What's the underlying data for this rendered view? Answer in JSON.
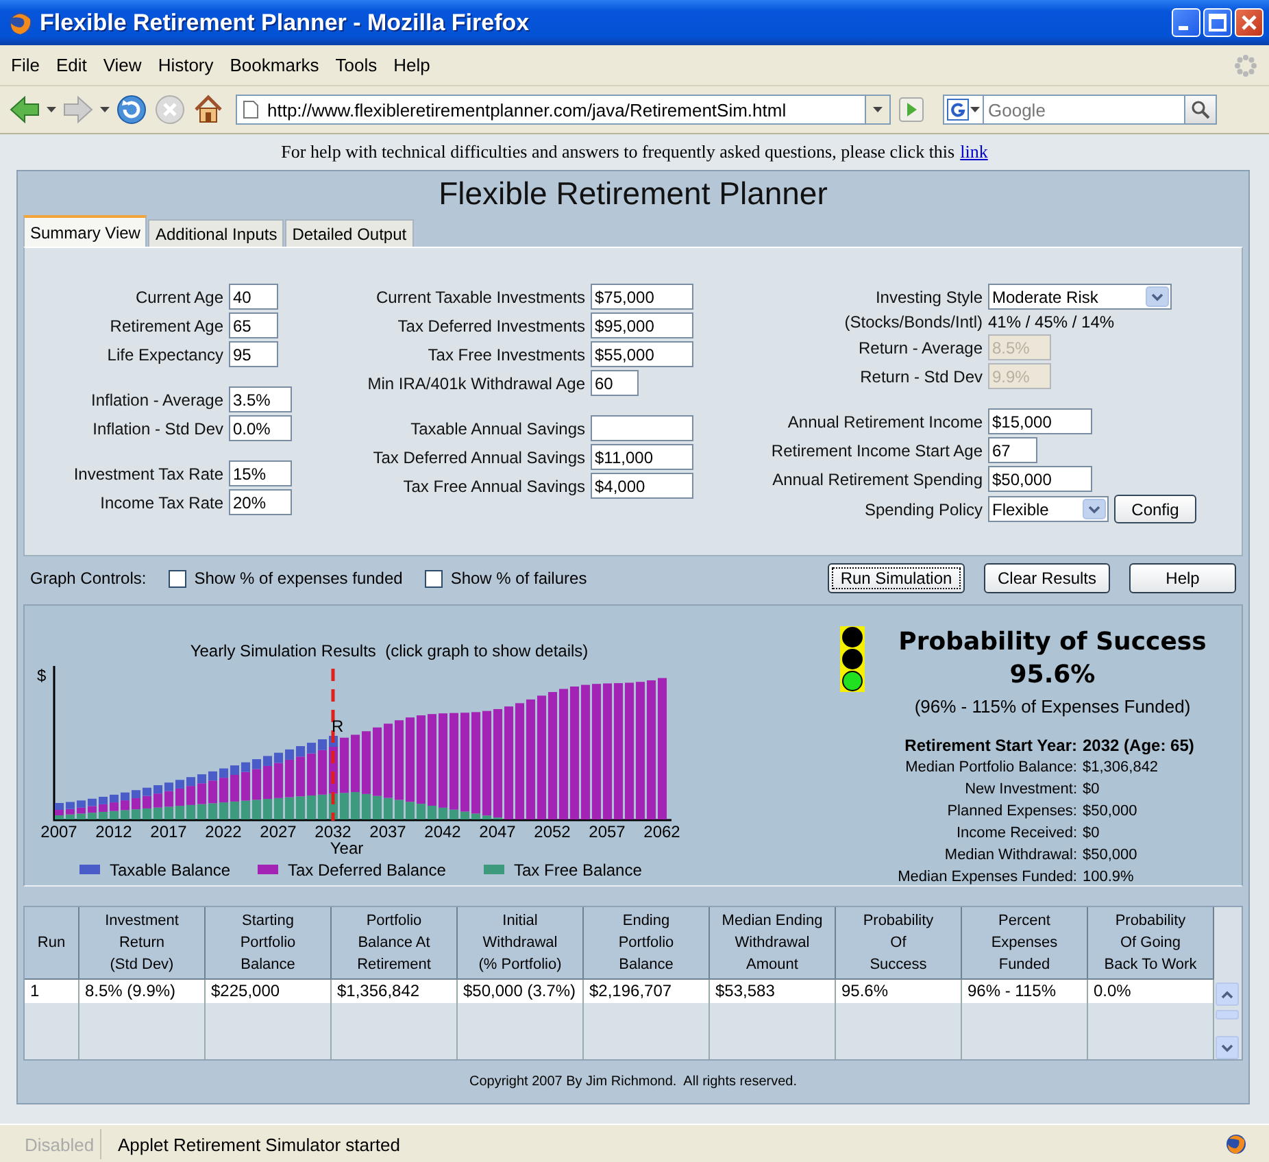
{
  "window": {
    "title": "Flexible Retirement Planner - Mozilla Firefox"
  },
  "menu": [
    "File",
    "Edit",
    "View",
    "History",
    "Bookmarks",
    "Tools",
    "Help"
  ],
  "address_bar": {
    "value": "http://www.flexibleretirementplanner.com/java/RetirementSim.html"
  },
  "search": {
    "placeholder": "Google"
  },
  "help_line": {
    "text": "For help with technical difficulties and answers to frequently asked questions, please click this",
    "link": "link"
  },
  "app_title": "Flexible Retirement Planner",
  "tabs": [
    {
      "label": "Summary View",
      "selected": true
    },
    {
      "label": "Additional Inputs",
      "selected": false
    },
    {
      "label": "Detailed Output",
      "selected": false
    }
  ],
  "input_columns": [
    [
      [
        {
          "label": "Current Age",
          "value": "40",
          "kind": "input",
          "disabled": false
        },
        {
          "label": "Retirement Age",
          "value": "65",
          "kind": "input",
          "disabled": false
        },
        {
          "label": "Life Expectancy",
          "value": "95",
          "kind": "input",
          "disabled": false
        }
      ],
      [
        {
          "label": "Inflation - Average",
          "value": "3.5%",
          "kind": "input",
          "disabled": false
        },
        {
          "label": "Inflation - Std Dev",
          "value": "0.0%",
          "kind": "input",
          "disabled": false
        }
      ],
      [
        {
          "label": "Investment Tax Rate",
          "value": "15%",
          "kind": "input",
          "disabled": false
        },
        {
          "label": "Income Tax Rate",
          "value": "20%",
          "kind": "input",
          "disabled": false
        }
      ]
    ],
    [
      [
        {
          "label": "Current Taxable Investments",
          "value": "$75,000",
          "kind": "input",
          "disabled": false
        },
        {
          "label": "Tax Deferred Investments",
          "value": "$95,000",
          "kind": "input",
          "disabled": false
        },
        {
          "label": "Tax Free Investments",
          "value": "$55,000",
          "kind": "input",
          "disabled": false
        },
        {
          "label": "Min IRA/401k Withdrawal Age",
          "value": "60",
          "kind": "input",
          "disabled": false
        }
      ],
      [
        {
          "label": "Taxable Annual Savings",
          "kind": "input",
          "disabled": false
        },
        {
          "label": "Tax Deferred Annual Savings",
          "value": "$11,000",
          "kind": "input",
          "disabled": false
        },
        {
          "label": "Tax Free Annual Savings",
          "value": "$4,000",
          "kind": "input",
          "disabled": false
        }
      ]
    ],
    [
      [
        {
          "label": "Investing Style",
          "value": "Moderate Risk",
          "kind": "select",
          "disabled": false
        },
        {
          "label": "(Stocks/Bonds/Intl)",
          "value": "41% / 45% / 14%",
          "kind": "readout",
          "disabled": false
        },
        {
          "label": "Return - Average",
          "value": "8.5%",
          "kind": "input",
          "disabled": true
        },
        {
          "label": "Return - Std Dev",
          "value": "9.9%",
          "kind": "input",
          "disabled": true
        }
      ],
      [
        {
          "label": "Annual Retirement Income",
          "value": "$15,000",
          "kind": "input",
          "disabled": false
        },
        {
          "label": "Retirement Income Start Age",
          "value": "67",
          "kind": "input",
          "disabled": false
        },
        {
          "label": "Annual Retirement Spending",
          "value": "$50,000",
          "kind": "input",
          "disabled": false
        },
        {
          "label": "Spending Policy",
          "value": "Flexible",
          "kind": "select",
          "disabled": false,
          "button": "Config"
        }
      ]
    ]
  ],
  "graph_controls": {
    "label": "Graph Controls:",
    "checkboxes": [
      {
        "label": "Show % of expenses funded",
        "checked": false
      },
      {
        "label": "Show % of failures",
        "checked": false
      }
    ],
    "buttons": [
      {
        "label": "Run Simulation",
        "focused": true
      },
      {
        "label": "Clear Results",
        "focused": false
      },
      {
        "label": "Help",
        "focused": false
      }
    ]
  },
  "chart": {
    "title": "Yearly Simulation Results  (click graph to show details)",
    "ylabel": "$",
    "xlabel": "Year",
    "retirement_marker": "R",
    "xticks": [
      "2007",
      "2012",
      "2017",
      "2022",
      "2027",
      "2032",
      "2037",
      "2042",
      "2047",
      "2052",
      "2057",
      "2062"
    ],
    "legend": [
      {
        "label": "Taxable Balance",
        "color": "#4a5cc8"
      },
      {
        "label": "Tax Deferred Balance",
        "color": "#a323b4"
      },
      {
        "label": "Tax Free Balance",
        "color": "#3e9a7c"
      }
    ]
  },
  "result": {
    "lights": [
      {
        "on": false
      },
      {
        "on": false
      },
      {
        "on": true
      }
    ],
    "heading": "Probability of Success",
    "value": "95.6%",
    "range": "(96% - 115% of Expenses Funded)",
    "details": [
      {
        "label": "Retirement Start Year:",
        "value": "2032 (Age: 65)",
        "emphasis": true
      },
      {
        "label": "Median Portfolio Balance:",
        "value": "$1,306,842",
        "emphasis": false
      },
      {
        "label": "New Investment:",
        "value": "$0",
        "emphasis": false
      },
      {
        "label": "Planned Expenses:",
        "value": "$50,000",
        "emphasis": false
      },
      {
        "label": "Income Received:",
        "value": "$0",
        "emphasis": false
      },
      {
        "label": "Median Withdrawal:",
        "value": "$50,000",
        "emphasis": false
      },
      {
        "label": "Median Expenses Funded:",
        "value": "100.9%",
        "emphasis": false
      }
    ]
  },
  "table": {
    "columns": [
      "Run",
      "Investment\nReturn\n(Std Dev)",
      "Starting\nPortfolio\nBalance",
      "Portfolio\nBalance At\nRetirement",
      "Initial\nWithdrawal\n(% Portfolio)",
      "Ending\nPortfolio\nBalance",
      "Median Ending\nWithdrawal\nAmount",
      "Probability\nOf\nSuccess",
      "Percent\nExpenses\nFunded",
      "Probability\nOf Going\nBack To Work"
    ],
    "rows": [
      [
        "1",
        "8.5% (9.9%)",
        "$225,000",
        "$1,356,842",
        "$50,000 (3.7%)",
        "$2,196,707",
        "$53,583",
        "95.6%",
        "96% - 115%",
        "0.0%"
      ]
    ]
  },
  "copyright": "Copyright 2007 By Jim Richmond.  All rights reserved.",
  "status_bar": {
    "state": "Disabled",
    "message": "Applet Retirement Simulator started"
  }
}
